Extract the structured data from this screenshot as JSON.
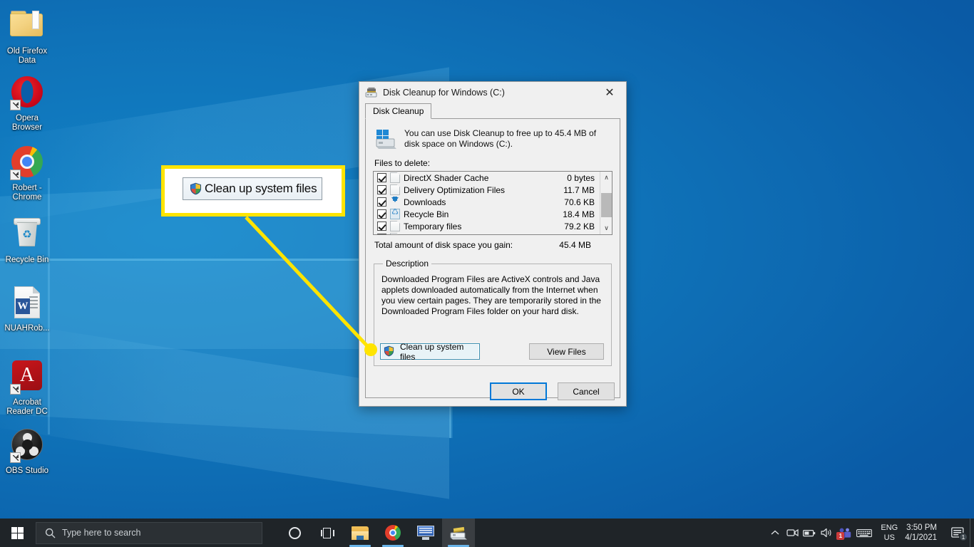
{
  "desktop": {
    "icons": [
      {
        "name": "Old Firefox Data",
        "type": "folder",
        "shortcut": false
      },
      {
        "name": "Opera Browser",
        "type": "opera",
        "shortcut": true
      },
      {
        "name": "Robert - Chrome",
        "type": "chrome",
        "shortcut": true
      },
      {
        "name": "Recycle Bin",
        "type": "recycle-bin",
        "shortcut": false
      },
      {
        "name": "NUAHRob...",
        "type": "word-document",
        "shortcut": false
      },
      {
        "name": "Acrobat Reader DC",
        "type": "acrobat",
        "shortcut": true
      },
      {
        "name": "OBS Studio",
        "type": "obs",
        "shortcut": true
      }
    ]
  },
  "callout": {
    "button_label": "Clean up system files",
    "icon": "uac-shield-icon",
    "border_color": "#ffe400",
    "line_color": "#ffe400"
  },
  "dialog": {
    "title": "Disk Cleanup for Windows (C:)",
    "title_icon": "disk-cleanup-icon",
    "close_label": "✕",
    "tab_label": "Disk Cleanup",
    "intro_text": "You can use Disk Cleanup to free up to 45.4 MB of disk space on Windows (C:).",
    "files_label": "Files to delete:",
    "file_list": [
      {
        "name": "DirectX Shader Cache",
        "size": "0 bytes",
        "checked": true,
        "icon": "document-icon"
      },
      {
        "name": "Delivery Optimization Files",
        "size": "11.7 MB",
        "checked": true,
        "icon": "document-icon"
      },
      {
        "name": "Downloads",
        "size": "70.6 KB",
        "checked": true,
        "icon": "download-arrow-icon"
      },
      {
        "name": "Recycle Bin",
        "size": "18.4 MB",
        "checked": true,
        "icon": "recycle-bin-icon"
      },
      {
        "name": "Temporary files",
        "size": "79.2 KB",
        "checked": true,
        "icon": "document-icon"
      }
    ],
    "scroll_up": "∧",
    "scroll_down": "∨",
    "total_label": "Total amount of disk space you gain:",
    "total_value": "45.4 MB",
    "description_legend": "Description",
    "description_text": "Downloaded Program Files are ActiveX controls and Java applets downloaded automatically from the Internet when you view certain pages. They are temporarily stored in the Downloaded Program Files folder on your hard disk.",
    "cleanup_button": "Clean up system files",
    "view_files_button": "View Files",
    "ok_button": "OK",
    "cancel_button": "Cancel",
    "focus_color": "#0078d7",
    "highlight_color": "#3b8fb0"
  },
  "taskbar": {
    "start_icon": "windows-logo-icon",
    "search_placeholder": "Type here to search",
    "search_icon": "search-icon",
    "items": [
      {
        "name": "Cortana",
        "icon": "cortana-circle-icon",
        "active": false
      },
      {
        "name": "Task View",
        "icon": "task-view-icon",
        "active": false
      },
      {
        "name": "File Explorer",
        "icon": "file-explorer-icon",
        "active": false
      },
      {
        "name": "Google Chrome",
        "icon": "chrome-icon",
        "active": false
      },
      {
        "name": "Remote Desktop",
        "icon": "monitor-icon",
        "active": false
      },
      {
        "name": "Disk Cleanup",
        "icon": "disk-cleanup-icon",
        "active": true
      }
    ],
    "tray": {
      "overflow_icon": "chevron-up-icon",
      "icons": [
        {
          "name": "screen-record-icon"
        },
        {
          "name": "battery-icon"
        },
        {
          "name": "volume-icon"
        },
        {
          "name": "microsoft-teams-icon",
          "badge": "1"
        },
        {
          "name": "keyboard-icon"
        }
      ],
      "language_line1": "ENG",
      "language_line2": "US",
      "time": "3:50 PM",
      "date": "4/1/2021",
      "notification_icon": "action-center-icon",
      "notification_badge": "1"
    }
  }
}
